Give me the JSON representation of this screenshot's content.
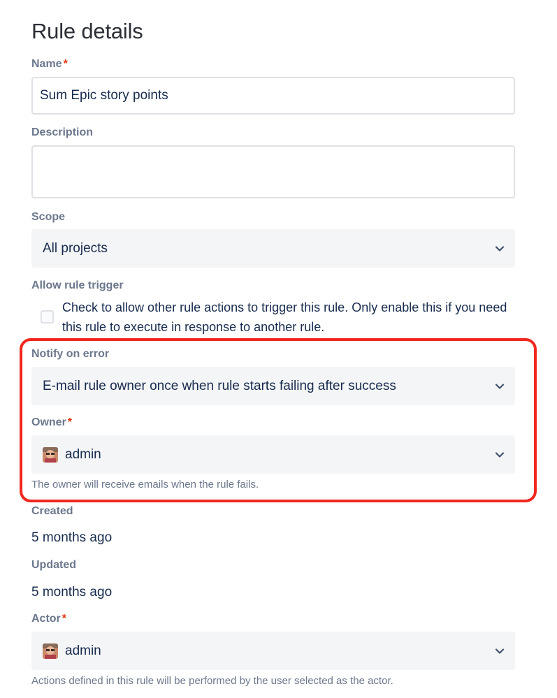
{
  "page_title": "Rule details",
  "name": {
    "label": "Name",
    "required_mark": "*",
    "value": "Sum Epic story points"
  },
  "description": {
    "label": "Description",
    "value": ""
  },
  "scope": {
    "label": "Scope",
    "value": "All projects"
  },
  "allow_rule_trigger": {
    "label": "Allow rule trigger",
    "checked": false,
    "text": "Check to allow other rule actions to trigger this rule. Only enable this if you need this rule to execute in response to another rule."
  },
  "notify_on_error": {
    "label": "Notify on error",
    "value": "E-mail rule owner once when rule starts failing after success"
  },
  "owner": {
    "label": "Owner",
    "required_mark": "*",
    "value": "admin",
    "helper": "The owner will receive emails when the rule fails."
  },
  "created": {
    "label": "Created",
    "value": "5 months ago"
  },
  "updated": {
    "label": "Updated",
    "value": "5 months ago"
  },
  "actor": {
    "label": "Actor",
    "required_mark": "*",
    "value": "admin",
    "helper": "Actions defined in this rule will be performed by the user selected as the actor."
  },
  "icons": {
    "dropdown": "chevron-down-icon",
    "avatar": "user-avatar"
  },
  "colors": {
    "highlight": "#F0281E",
    "required": "#DE350B",
    "label": "#6B778C",
    "text": "#172B4D",
    "select_bg": "#F4F5F7"
  }
}
